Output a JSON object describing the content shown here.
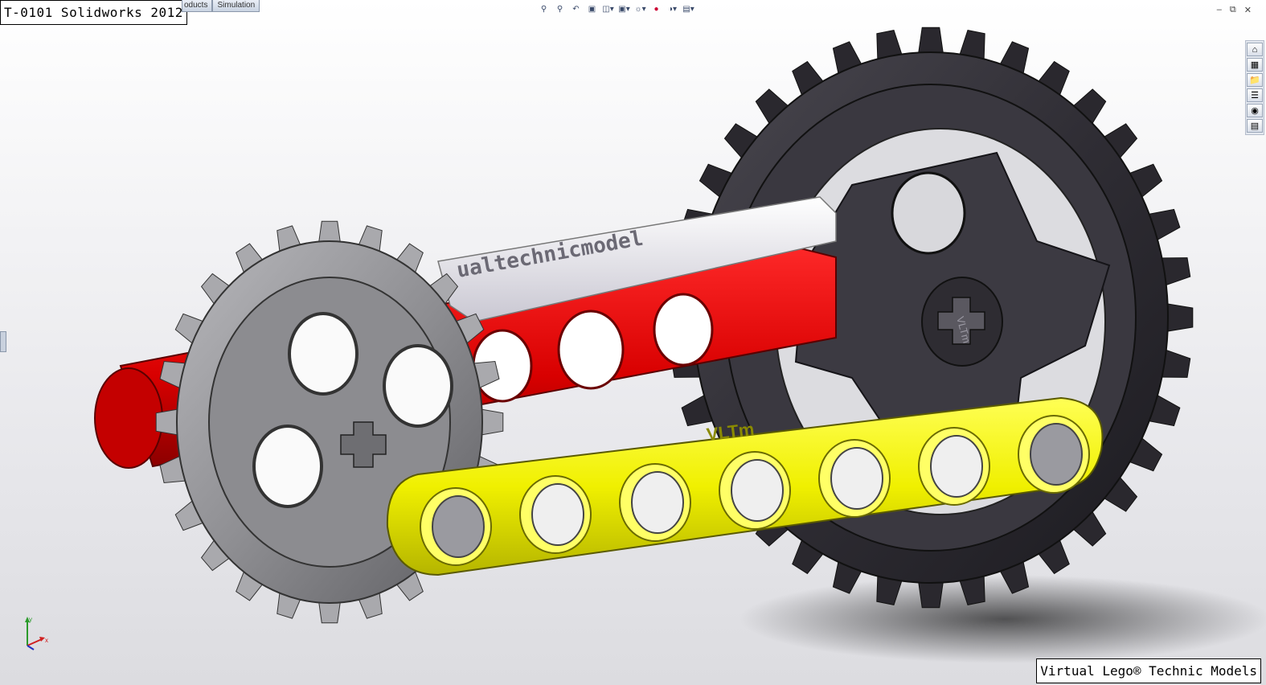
{
  "overlay": {
    "title": "T-0101 Solidworks 2012",
    "footer": "Virtual Lego® Technic Models"
  },
  "command_tabs": [
    {
      "label": "oducts"
    },
    {
      "label": "Simulation"
    }
  ],
  "heads_up_toolbar": [
    {
      "icon": "zoom-to-fit-icon"
    },
    {
      "icon": "zoom-to-area-icon"
    },
    {
      "icon": "previous-view-icon"
    },
    {
      "icon": "section-view-icon"
    },
    {
      "icon": "view-orientation-icon"
    },
    {
      "icon": "display-style-icon"
    },
    {
      "icon": "hide-show-items-icon"
    },
    {
      "icon": "edit-appearance-icon"
    },
    {
      "icon": "apply-scene-icon"
    },
    {
      "icon": "view-settings-icon"
    }
  ],
  "task_pane": [
    {
      "icon": "home-icon"
    },
    {
      "icon": "resources-icon"
    },
    {
      "icon": "design-library-icon"
    },
    {
      "icon": "file-explorer-icon"
    },
    {
      "icon": "appearances-icon"
    },
    {
      "icon": "custom-properties-icon"
    }
  ],
  "model_engravings": {
    "beam_text": "ualtechnicmodel",
    "liftarm_text": "VLTm",
    "gear_text": "VLTm"
  },
  "colors": {
    "red_beam": "#e00000",
    "yellow_liftarm": "#f2f200",
    "gray_gear": "#8a8a8e",
    "black_gear": "#2e2c32",
    "white_beam": "#f4f4f8"
  }
}
